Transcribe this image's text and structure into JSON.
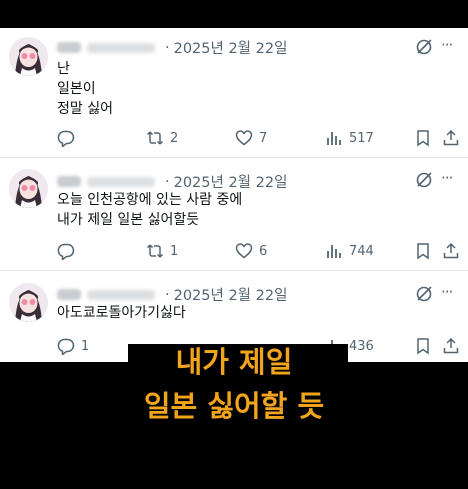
{
  "posts": [
    {
      "date": "2025년 2월 22일",
      "lines": [
        "난",
        "일본이",
        "정말 싫어"
      ],
      "replies": "",
      "reposts": "2",
      "likes": "7",
      "views": "517"
    },
    {
      "date": "2025년 2월 22일",
      "lines": [
        "오늘 인천공항에 있는 사람 중에",
        "내가 제일 일본 싫어할듯"
      ],
      "replies": "",
      "reposts": "1",
      "likes": "6",
      "views": "744"
    },
    {
      "date": "2025년 2월 22일",
      "lines": [
        "아도쿄로돌아가기싫다"
      ],
      "replies": "1",
      "reposts": "",
      "likes": "",
      "views": "436"
    }
  ],
  "caption": {
    "line1": "내가 제일",
    "line2": "일본 싫어할 듯"
  },
  "colors": {
    "caption": "#f2a41c",
    "text": "#0f1419",
    "muted": "#536471"
  },
  "icons": [
    "grok-icon",
    "more-icon",
    "reply-icon",
    "repost-icon",
    "like-icon",
    "views-icon",
    "bookmark-icon",
    "share-icon"
  ]
}
